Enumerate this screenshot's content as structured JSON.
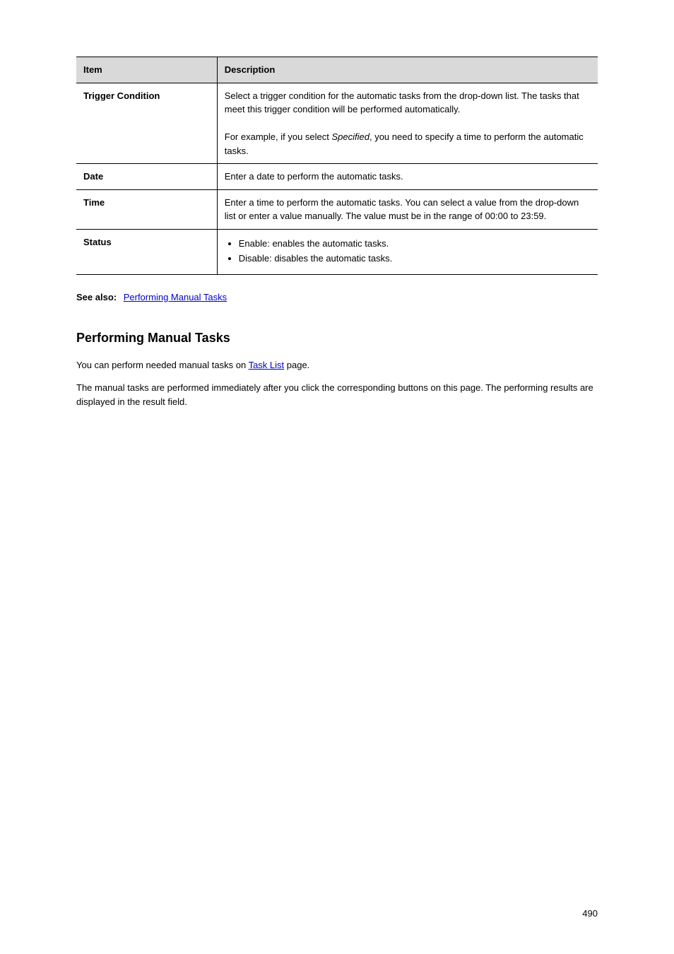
{
  "table": {
    "header": {
      "col1": "Item",
      "col2": "Description"
    },
    "rows": [
      {
        "label": "Trigger Condition",
        "desc_html": "Select a trigger condition for the automatic tasks from the drop-down list. The tasks that meet this trigger condition will be performed automatically.\n\nFor example, if you select <i>Specified</i>, you need to specify a time to perform the automatic tasks."
      },
      {
        "label": "Date",
        "desc_html": "Enter a date to perform the automatic tasks."
      },
      {
        "label": "Time",
        "desc_html": "Enter a time to perform the automatic tasks. You can select a value from the drop-down list or enter a value manually. The value must be in the range of 00:00 to 23:59."
      },
      {
        "label": "Status",
        "bullets": [
          "Enable: enables the automatic tasks.",
          "Disable: disables the automatic tasks."
        ]
      }
    ]
  },
  "see_also": {
    "label": "See also:",
    "link_text": "Performing Manual Tasks"
  },
  "section": {
    "heading": "Performing Manual Tasks",
    "para1_before": "You can perform needed manual tasks on ",
    "para1_link": "Task List",
    "para1_after": " page.",
    "para2": "The manual tasks are performed immediately after you click the corresponding buttons on this page. The performing results are displayed in the result field."
  },
  "page_number": "490"
}
